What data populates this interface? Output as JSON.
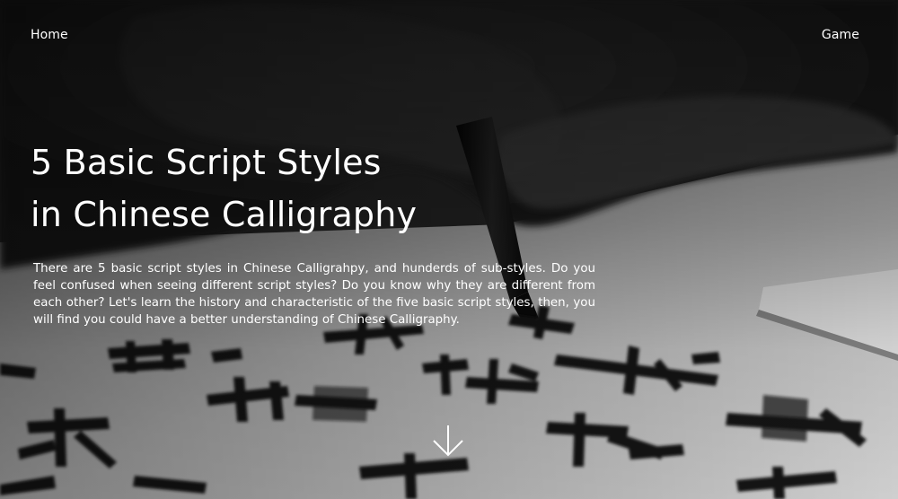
{
  "nav": {
    "home_label": "Home",
    "game_label": "Game"
  },
  "hero": {
    "title_line_1": "5 Basic Script Styles",
    "title_line_2": "in Chinese Calligraphy",
    "intro": "There are 5 basic script styles in Chinese Calligrahpy, and hunderds of sub-styles. Do you feel confused when seeing different script styles? Do you know why they are different from each other? Let's learn the history and characteristic of the five basic script styles, then, you will find you could have a better understanding of Chinese Calligraphy.",
    "scroll_icon": "arrow-down-icon"
  },
  "colors": {
    "text": "#ffffff",
    "overlay": "#000000"
  }
}
